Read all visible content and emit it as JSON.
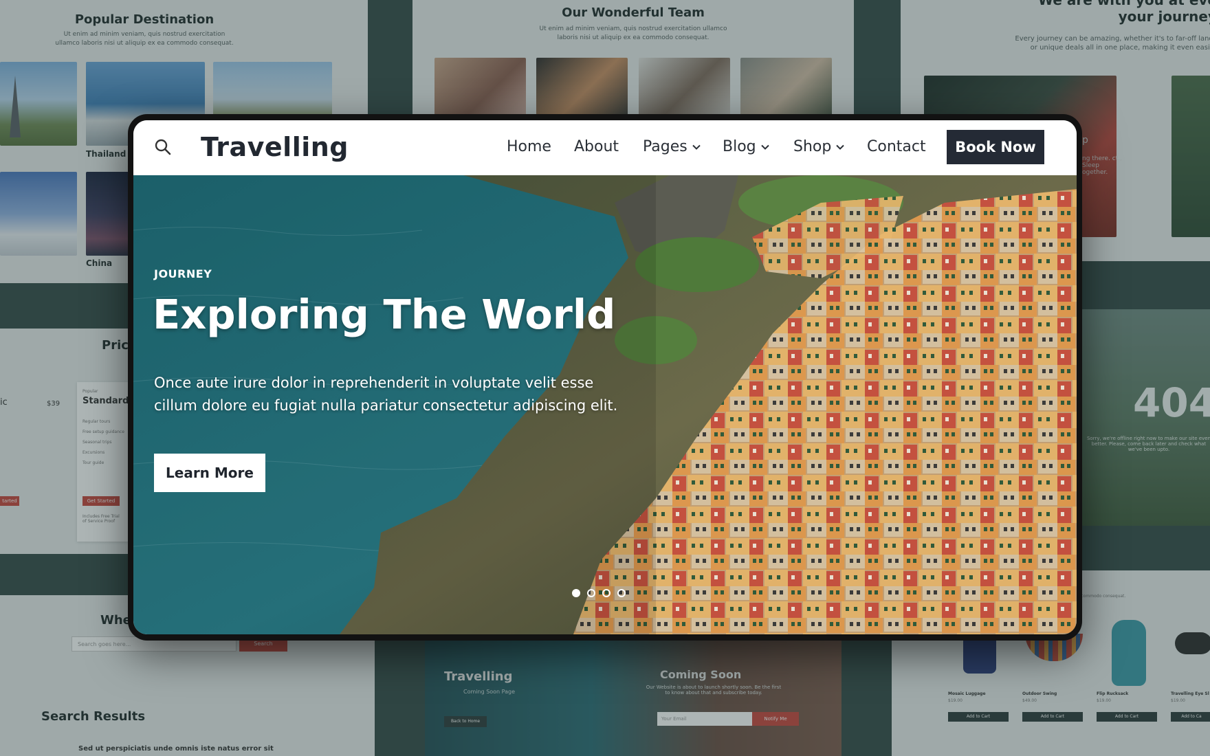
{
  "background": {
    "destinations": {
      "title": "Popular Destination",
      "subtitle": "Ut enim ad minim veniam, quis nostrud exercitation ullamco laboris nisi ut aliquip ex ea commodo consequat.",
      "captions": [
        "Thailand",
        "China"
      ]
    },
    "team": {
      "title": "Our Wonderful Team",
      "subtitle": "Ut enim ad minim veniam, quis nostrud exercitation ullamco laboris nisi ut aliquip ex ea commodo consequat."
    },
    "journey": {
      "title_line1": "We are with you at eve",
      "title_line2": "your journey",
      "text": "Every journey can be amazing, whether it's to far-off lands or unique deals all in one place, making it even easier",
      "side_text": "ng there. ct., Sleep ogether.",
      "side_p": "p"
    },
    "pricing": {
      "title": "Prici",
      "plan_fragment": "ic",
      "price": "$39",
      "plan_small": "Popular",
      "plan_name": "Standard",
      "features": [
        "Regular tours",
        "Free setup guidance",
        "Seasonal trips",
        "Excursions",
        "Tour guide"
      ],
      "cta": "Get Started",
      "cta_fragment": "tarted",
      "footnote": "Includes Free Trial of Service Proof"
    },
    "search_panel": {
      "title_fragment": "Whe",
      "placeholder": "Search goes here...",
      "button": "Search",
      "results_title": "Search Results",
      "result_text": "Sed ut perspiciatis unde omnis iste natus error sit"
    },
    "error_page": {
      "code": "404",
      "text": "Sorry, we're offline right now to make our site even better. Please, come back later and check what we've been upto."
    },
    "coming_soon": {
      "brand": "Travelling",
      "brand_sub": "Coming Soon Page",
      "back": "Back to Home",
      "title": "Coming Soon",
      "text": "Our Website is about to launch shortly soon. Be the first to know about that and subscribe today.",
      "email_placeholder": "Your Email",
      "notify": "Notify Me"
    },
    "shop": {
      "title_fragment": "mmerce",
      "subtitle": "exercitation ullamco laboris nisi ut aliquip ex ea commodo consequat.",
      "products": [
        {
          "name": "Mosaic Luggage",
          "price": "$19.00",
          "button": "Add to Cart"
        },
        {
          "name": "Outdoor Swing",
          "price": "$49.00",
          "button": "Add to Cart"
        },
        {
          "name": "Flip Rucksack",
          "price": "$19.00",
          "button": "Add to Cart"
        },
        {
          "name": "Travelling Eye Sl",
          "price": "$19.00",
          "button": "Add to Ca"
        }
      ]
    }
  },
  "site": {
    "logo": "Travelling",
    "nav": [
      {
        "label": "Home",
        "dropdown": false
      },
      {
        "label": "About",
        "dropdown": false
      },
      {
        "label": "Pages",
        "dropdown": true
      },
      {
        "label": "Blog",
        "dropdown": true
      },
      {
        "label": "Shop",
        "dropdown": true
      },
      {
        "label": "Contact",
        "dropdown": false
      }
    ],
    "cta": "Book Now",
    "search_icon": "search-icon"
  },
  "hero": {
    "kicker": "JOURNEY",
    "headline": "Exploring The World",
    "description": "Once aute irure dolor in reprehenderit in voluptate velit esse cillum dolore eu fugiat nulla pariatur consectetur adipiscing elit.",
    "button": "Learn More",
    "slides_total": 4,
    "active_slide": 1
  },
  "colors": {
    "dark": "#242a35",
    "sea": "#2b7f8a",
    "accent_red": "#c9463d"
  }
}
